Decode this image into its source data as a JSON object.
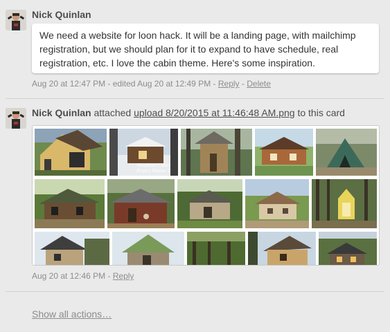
{
  "comment": {
    "author": "Nick Quinlan",
    "text": "We need a website for loon hack. It will be a landing page, with mailchimp registration, but we should plan for it to expand to have schedule, real registration, etc. I love the cabin theme. Here's some inspiration.",
    "meta": {
      "timestamp": "Aug 20 at 12:47 PM",
      "edited": "edited Aug 20 at 12:49 PM",
      "separator": " - ",
      "reply_label": "Reply",
      "delete_label": "Delete"
    }
  },
  "attachment_action": {
    "author": "Nick Quinlan",
    "verb": "attached",
    "file_name": "upload 8/20/2015 at 11:46:48 AM.png",
    "suffix": "to this card",
    "image_text": "Woodlawn Cabin Project Volume 1",
    "meta": {
      "timestamp": "Aug 20 at 12:46 PM",
      "separator": " - ",
      "reply_label": "Reply"
    }
  },
  "show_all_label": "Show all actions…",
  "colors": {
    "background": "#eaeaea",
    "card": "#ffffff",
    "text": "#4d4d4d",
    "muted": "#8c8c8c",
    "divider": "#d2d2d2"
  },
  "icons": {
    "avatar": "user-avatar-photo"
  }
}
